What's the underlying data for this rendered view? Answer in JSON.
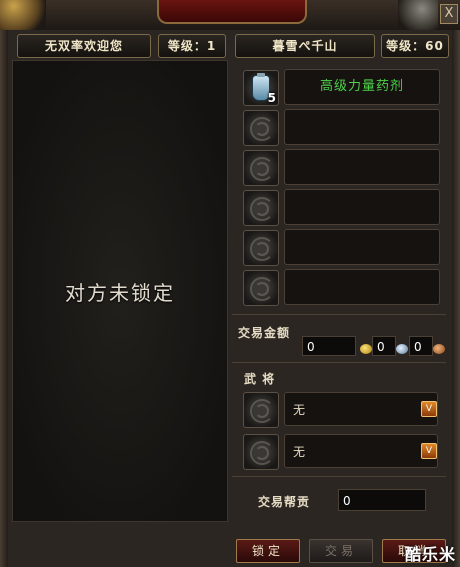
{
  "header": {
    "left_player_name": "无双率欢迎您",
    "left_level_label": "等级：1",
    "right_player_name": "暮雪ぺ千山",
    "right_level_label": "等级：60",
    "close_glyph": "X"
  },
  "left_panel": {
    "status_text": "对方未锁定"
  },
  "items": [
    {
      "name": "高级力量药剂",
      "quantity": "5",
      "icon": "potion-icon"
    },
    {
      "name": "",
      "quantity": "",
      "icon": "empty-slot-icon"
    },
    {
      "name": "",
      "quantity": "",
      "icon": "empty-slot-icon"
    },
    {
      "name": "",
      "quantity": "",
      "icon": "empty-slot-icon"
    },
    {
      "name": "",
      "quantity": "",
      "icon": "empty-slot-icon"
    },
    {
      "name": "",
      "quantity": "",
      "icon": "empty-slot-icon"
    }
  ],
  "trade_money": {
    "label": "交易金额",
    "gold": "0",
    "silver": "0",
    "copper": "0"
  },
  "generals": {
    "label": "武 将",
    "slots": [
      {
        "name": "无"
      },
      {
        "name": "无"
      }
    ],
    "dropdown_glyph": "V"
  },
  "contribution": {
    "label": "交易帮贡",
    "value": "0"
  },
  "buttons": {
    "lock": "锁定",
    "trade": "交易",
    "cancel": "取消"
  },
  "watermark": "酷乐米",
  "colors": {
    "item_name": "#4fd14a",
    "button_red": "#5a1a16"
  }
}
